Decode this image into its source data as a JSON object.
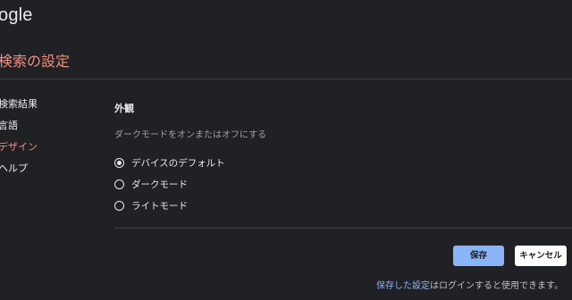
{
  "header": {
    "logo_text": "ogle",
    "page_title": "検索の設定"
  },
  "sidebar": {
    "items": [
      {
        "label": "検索結果",
        "active": false
      },
      {
        "label": "言語",
        "active": false
      },
      {
        "label": "デザイン",
        "active": true
      },
      {
        "label": "ヘルプ",
        "active": false
      }
    ]
  },
  "appearance": {
    "title": "外観",
    "description": "ダークモードをオンまたはオフにする",
    "options": [
      {
        "label": "デバイスのデフォルト",
        "selected": true
      },
      {
        "label": "ダークモード",
        "selected": false
      },
      {
        "label": "ライトモード",
        "selected": false
      }
    ]
  },
  "actions": {
    "save_label": "保存",
    "cancel_label": "キャンセル"
  },
  "footer": {
    "link_text": "保存した設定",
    "note_text": "はログインすると使用できます。"
  },
  "colors": {
    "background": "#202124",
    "accent_active": "#f28b82",
    "primary_button": "#8ab4f8",
    "link": "#8ab4f8"
  }
}
